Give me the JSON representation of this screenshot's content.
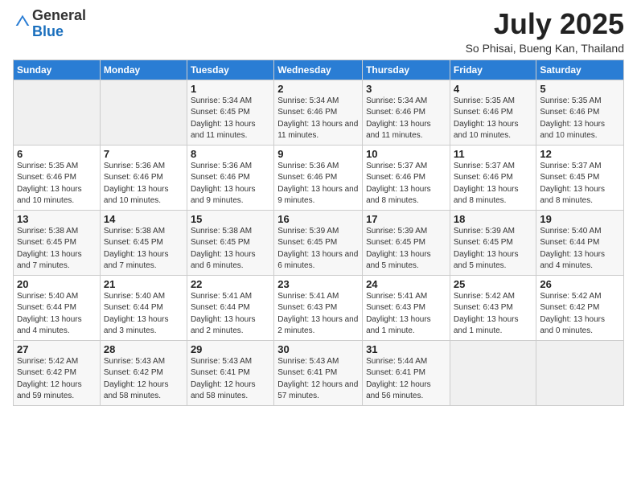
{
  "header": {
    "logo_general": "General",
    "logo_blue": "Blue",
    "month_title": "July 2025",
    "subtitle": "So Phisai, Bueng Kan, Thailand"
  },
  "weekdays": [
    "Sunday",
    "Monday",
    "Tuesday",
    "Wednesday",
    "Thursday",
    "Friday",
    "Saturday"
  ],
  "weeks": [
    [
      {
        "day": "",
        "info": ""
      },
      {
        "day": "",
        "info": ""
      },
      {
        "day": "1",
        "info": "Sunrise: 5:34 AM\nSunset: 6:45 PM\nDaylight: 13 hours and 11 minutes."
      },
      {
        "day": "2",
        "info": "Sunrise: 5:34 AM\nSunset: 6:46 PM\nDaylight: 13 hours and 11 minutes."
      },
      {
        "day": "3",
        "info": "Sunrise: 5:34 AM\nSunset: 6:46 PM\nDaylight: 13 hours and 11 minutes."
      },
      {
        "day": "4",
        "info": "Sunrise: 5:35 AM\nSunset: 6:46 PM\nDaylight: 13 hours and 10 minutes."
      },
      {
        "day": "5",
        "info": "Sunrise: 5:35 AM\nSunset: 6:46 PM\nDaylight: 13 hours and 10 minutes."
      }
    ],
    [
      {
        "day": "6",
        "info": "Sunrise: 5:35 AM\nSunset: 6:46 PM\nDaylight: 13 hours and 10 minutes."
      },
      {
        "day": "7",
        "info": "Sunrise: 5:36 AM\nSunset: 6:46 PM\nDaylight: 13 hours and 10 minutes."
      },
      {
        "day": "8",
        "info": "Sunrise: 5:36 AM\nSunset: 6:46 PM\nDaylight: 13 hours and 9 minutes."
      },
      {
        "day": "9",
        "info": "Sunrise: 5:36 AM\nSunset: 6:46 PM\nDaylight: 13 hours and 9 minutes."
      },
      {
        "day": "10",
        "info": "Sunrise: 5:37 AM\nSunset: 6:46 PM\nDaylight: 13 hours and 8 minutes."
      },
      {
        "day": "11",
        "info": "Sunrise: 5:37 AM\nSunset: 6:46 PM\nDaylight: 13 hours and 8 minutes."
      },
      {
        "day": "12",
        "info": "Sunrise: 5:37 AM\nSunset: 6:45 PM\nDaylight: 13 hours and 8 minutes."
      }
    ],
    [
      {
        "day": "13",
        "info": "Sunrise: 5:38 AM\nSunset: 6:45 PM\nDaylight: 13 hours and 7 minutes."
      },
      {
        "day": "14",
        "info": "Sunrise: 5:38 AM\nSunset: 6:45 PM\nDaylight: 13 hours and 7 minutes."
      },
      {
        "day": "15",
        "info": "Sunrise: 5:38 AM\nSunset: 6:45 PM\nDaylight: 13 hours and 6 minutes."
      },
      {
        "day": "16",
        "info": "Sunrise: 5:39 AM\nSunset: 6:45 PM\nDaylight: 13 hours and 6 minutes."
      },
      {
        "day": "17",
        "info": "Sunrise: 5:39 AM\nSunset: 6:45 PM\nDaylight: 13 hours and 5 minutes."
      },
      {
        "day": "18",
        "info": "Sunrise: 5:39 AM\nSunset: 6:45 PM\nDaylight: 13 hours and 5 minutes."
      },
      {
        "day": "19",
        "info": "Sunrise: 5:40 AM\nSunset: 6:44 PM\nDaylight: 13 hours and 4 minutes."
      }
    ],
    [
      {
        "day": "20",
        "info": "Sunrise: 5:40 AM\nSunset: 6:44 PM\nDaylight: 13 hours and 4 minutes."
      },
      {
        "day": "21",
        "info": "Sunrise: 5:40 AM\nSunset: 6:44 PM\nDaylight: 13 hours and 3 minutes."
      },
      {
        "day": "22",
        "info": "Sunrise: 5:41 AM\nSunset: 6:44 PM\nDaylight: 13 hours and 2 minutes."
      },
      {
        "day": "23",
        "info": "Sunrise: 5:41 AM\nSunset: 6:43 PM\nDaylight: 13 hours and 2 minutes."
      },
      {
        "day": "24",
        "info": "Sunrise: 5:41 AM\nSunset: 6:43 PM\nDaylight: 13 hours and 1 minute."
      },
      {
        "day": "25",
        "info": "Sunrise: 5:42 AM\nSunset: 6:43 PM\nDaylight: 13 hours and 1 minute."
      },
      {
        "day": "26",
        "info": "Sunrise: 5:42 AM\nSunset: 6:42 PM\nDaylight: 13 hours and 0 minutes."
      }
    ],
    [
      {
        "day": "27",
        "info": "Sunrise: 5:42 AM\nSunset: 6:42 PM\nDaylight: 12 hours and 59 minutes."
      },
      {
        "day": "28",
        "info": "Sunrise: 5:43 AM\nSunset: 6:42 PM\nDaylight: 12 hours and 58 minutes."
      },
      {
        "day": "29",
        "info": "Sunrise: 5:43 AM\nSunset: 6:41 PM\nDaylight: 12 hours and 58 minutes."
      },
      {
        "day": "30",
        "info": "Sunrise: 5:43 AM\nSunset: 6:41 PM\nDaylight: 12 hours and 57 minutes."
      },
      {
        "day": "31",
        "info": "Sunrise: 5:44 AM\nSunset: 6:41 PM\nDaylight: 12 hours and 56 minutes."
      },
      {
        "day": "",
        "info": ""
      },
      {
        "day": "",
        "info": ""
      }
    ]
  ]
}
